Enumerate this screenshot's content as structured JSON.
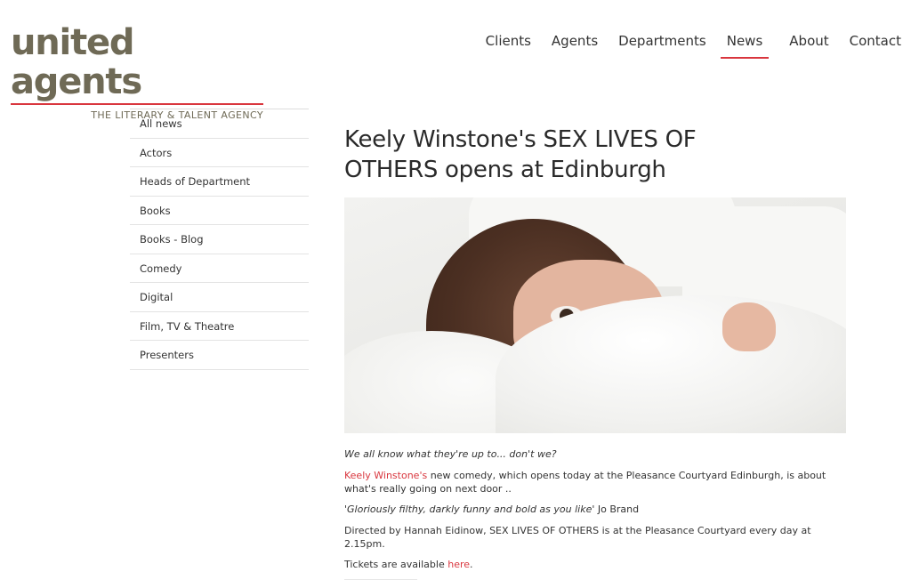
{
  "logo": {
    "wordmark": "united agents",
    "tagline": "THE LITERARY & TALENT AGENCY"
  },
  "nav": {
    "items": [
      {
        "label": "Clients"
      },
      {
        "label": "Agents"
      },
      {
        "label": "Departments"
      },
      {
        "label": "News",
        "active": true
      },
      {
        "label": "About"
      },
      {
        "label": "Contact"
      }
    ]
  },
  "sidebar": {
    "items": [
      {
        "label": "All news"
      },
      {
        "label": "Actors"
      },
      {
        "label": "Heads of Department"
      },
      {
        "label": "Books"
      },
      {
        "label": "Books - Blog"
      },
      {
        "label": "Comedy"
      },
      {
        "label": "Digital"
      },
      {
        "label": "Film, TV & Theatre"
      },
      {
        "label": "Presenters"
      }
    ]
  },
  "article": {
    "title": "Keely Winstone's SEX LIVES OF OTHERS opens at Edinburgh",
    "intro": "We all know what they're up to... don't we?",
    "p2_link": "Keely Winstone's",
    "p2_text": " new comedy, which opens today at the Pleasance Courtyard Edinburgh, is about what's really going on next door ..",
    "quote_open": "'",
    "quote": "Gloriously filthy, darkly funny and bold as you like",
    "quote_close": "' Jo Brand",
    "p4": "Directed by Hannah Eidinow, SEX LIVES OF OTHERS is at the Pleasance Courtyard every day at 2.15pm.",
    "p5_text": "Tickets are available ",
    "p5_link": "here",
    "p5_end": "."
  },
  "colors": {
    "accent": "#d9363e",
    "logo": "#6f6a56"
  }
}
